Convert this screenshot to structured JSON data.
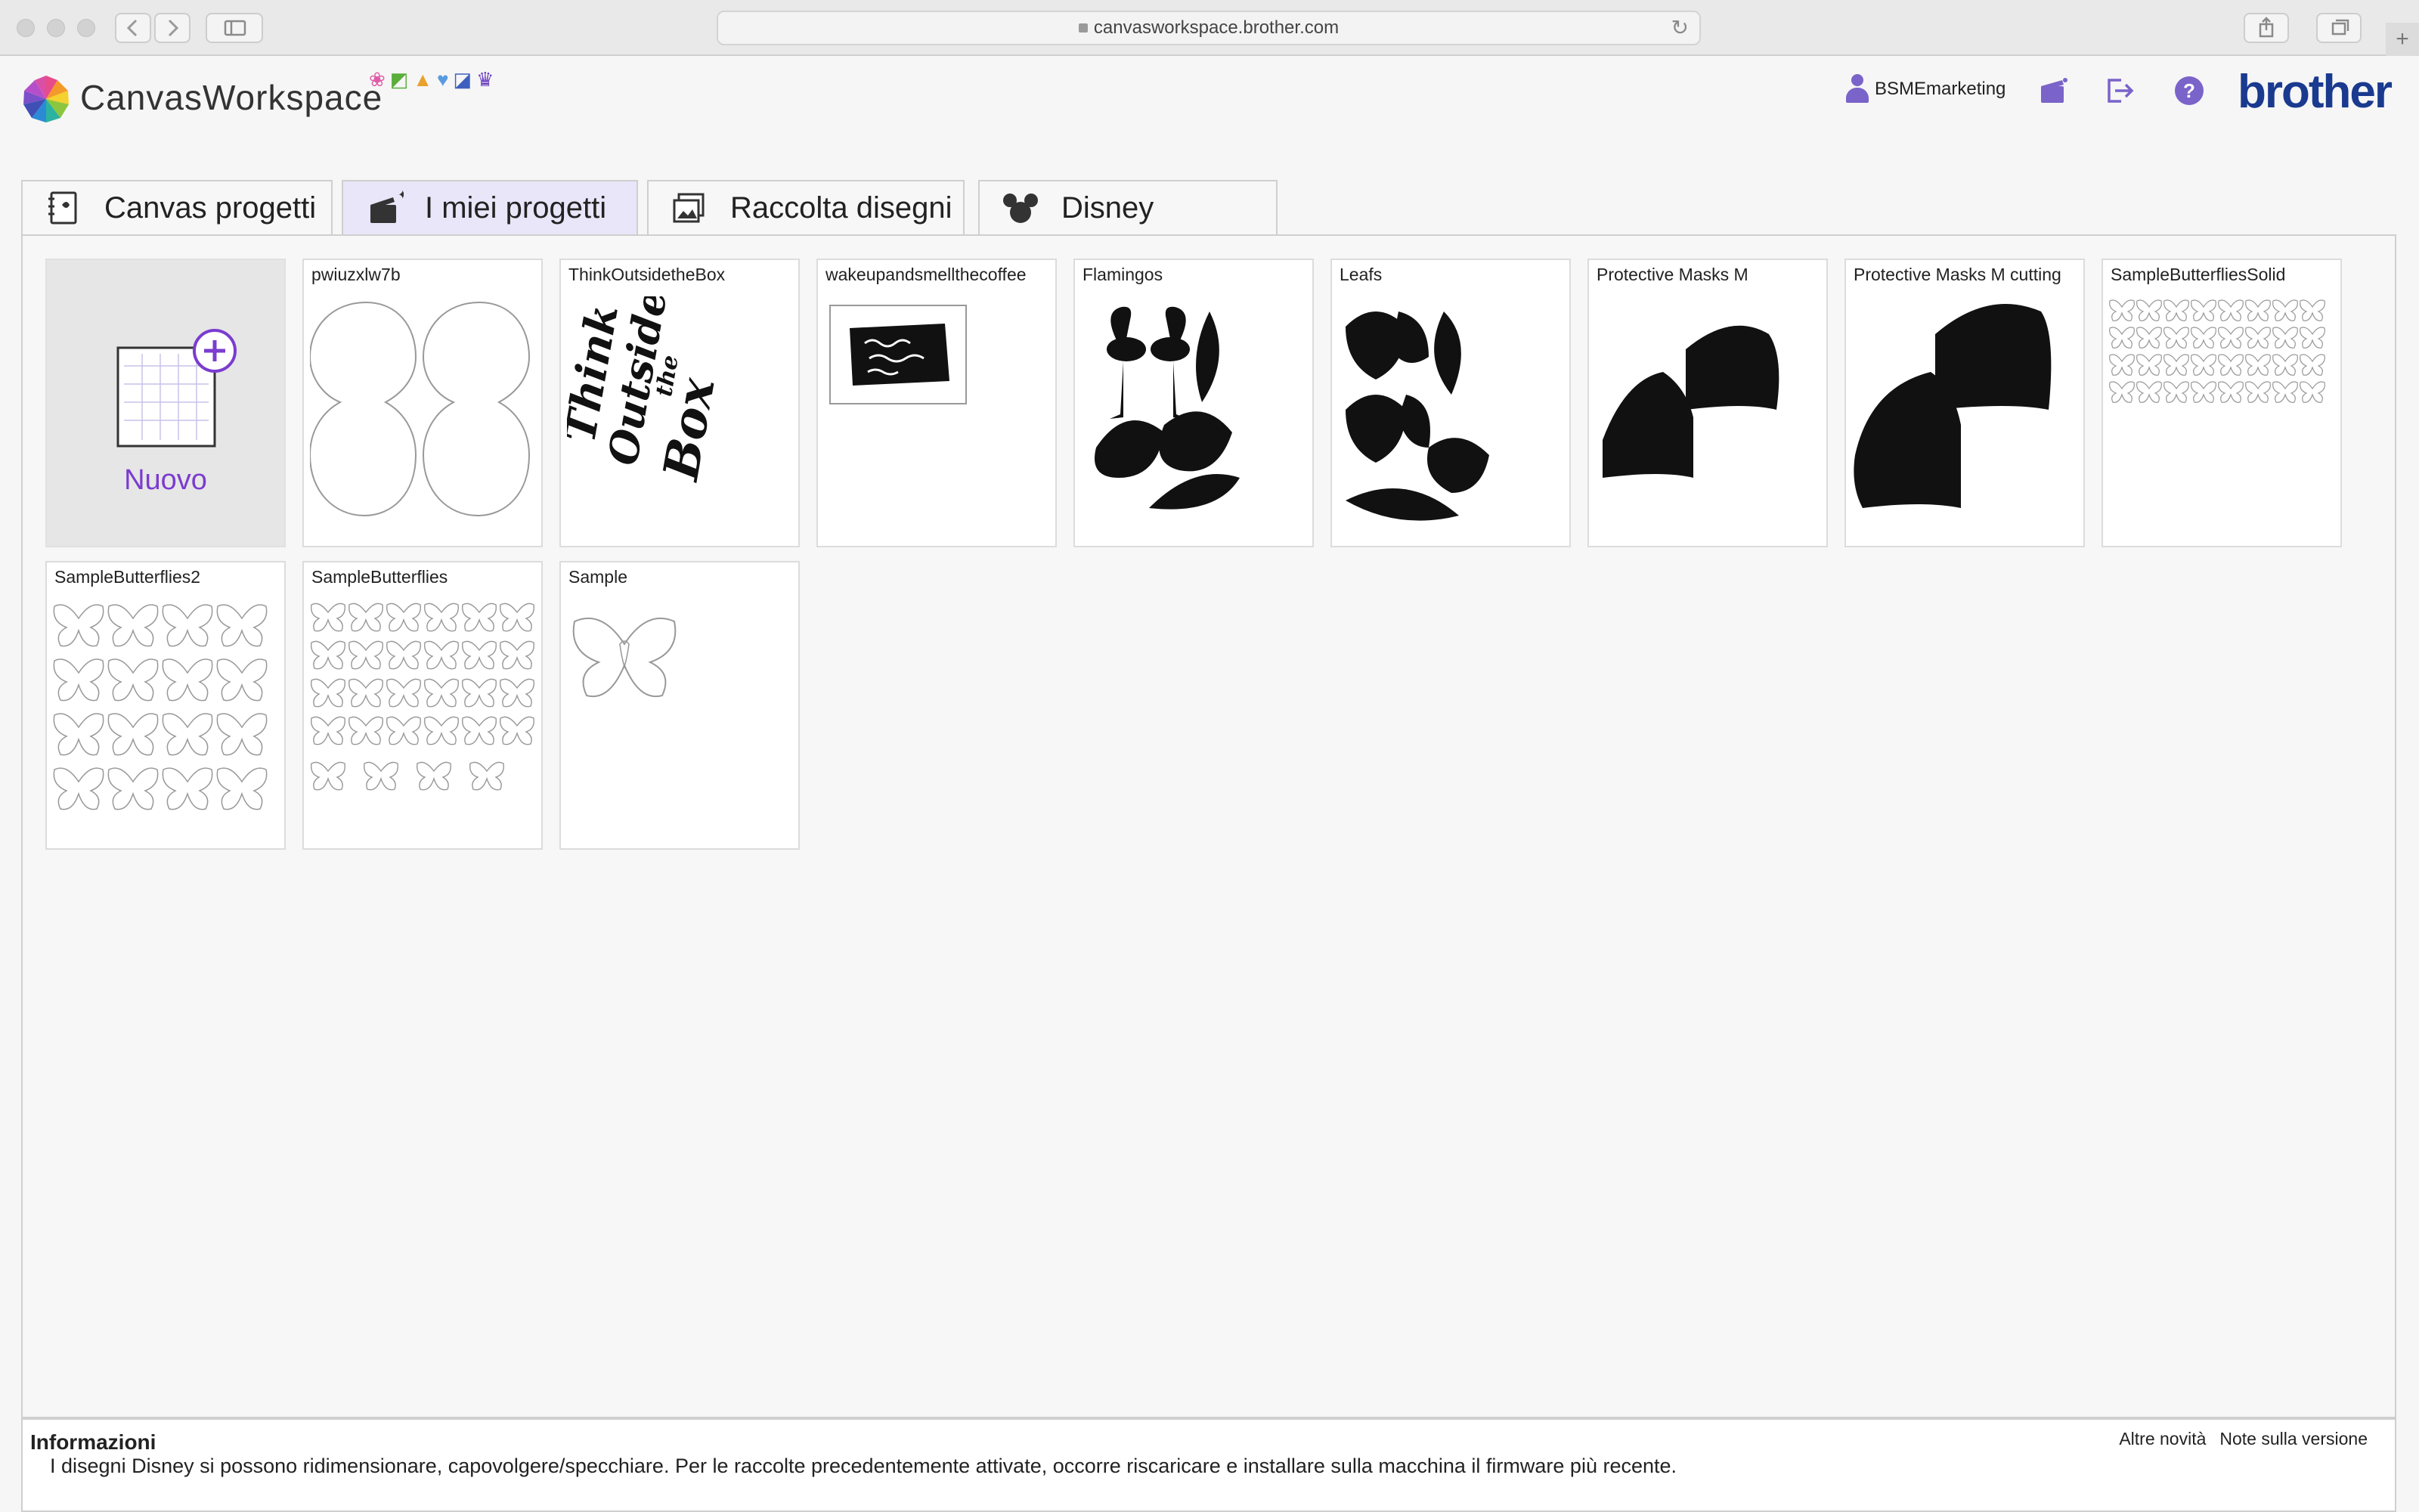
{
  "browser": {
    "url": "canvasworkspace.brother.com"
  },
  "header": {
    "brand": "CanvasWorkspace",
    "user_name": "BSMEmarketing",
    "logo_text": "brother",
    "mini_icons": [
      "flower-icon",
      "leaf-icon",
      "cake-icon",
      "heart-icon",
      "cards-icon",
      "crown-icon"
    ],
    "accent_color": "#7a63c9"
  },
  "tabs": [
    {
      "label": "Canvas progetti",
      "icon": "notebook-icon"
    },
    {
      "label": "I miei progetti",
      "icon": "clapper-icon",
      "active": true
    },
    {
      "label": "Raccolta disegni",
      "icon": "gallery-icon"
    },
    {
      "label": "Disney",
      "icon": "mouse-ears-icon"
    }
  ],
  "projects": {
    "new_label": "Nuovo",
    "items": [
      {
        "title": "pwiuzxlw7b",
        "thumb": "circles"
      },
      {
        "title": "ThinkOutsidetheBox",
        "thumb": "lettering"
      },
      {
        "title": "wakeupandsmellthecoffee",
        "thumb": "mug-wrap"
      },
      {
        "title": "Flamingos",
        "thumb": "flamingos"
      },
      {
        "title": "Leafs",
        "thumb": "leaves"
      },
      {
        "title": "Protective Masks M",
        "thumb": "masks"
      },
      {
        "title": "Protective Masks M cutting",
        "thumb": "masks-large"
      },
      {
        "title": "SampleButterfliesSolid",
        "thumb": "butterfly-grid-small"
      },
      {
        "title": "SampleButterflies2",
        "thumb": "butterfly-grid-medium"
      },
      {
        "title": "SampleButterflies",
        "thumb": "butterfly-grid-dense"
      },
      {
        "title": "Sample",
        "thumb": "butterfly-single"
      }
    ]
  },
  "info": {
    "title": "Informazioni",
    "text": "I disegni Disney si possono ridimensionare, capovolgere/specchiare. Per le raccolte precedentemente attivate, occorre riscaricare e installare sulla macchina il firmware più recente.",
    "link_news": "Altre novità",
    "link_notes": "Note sulla versione"
  }
}
